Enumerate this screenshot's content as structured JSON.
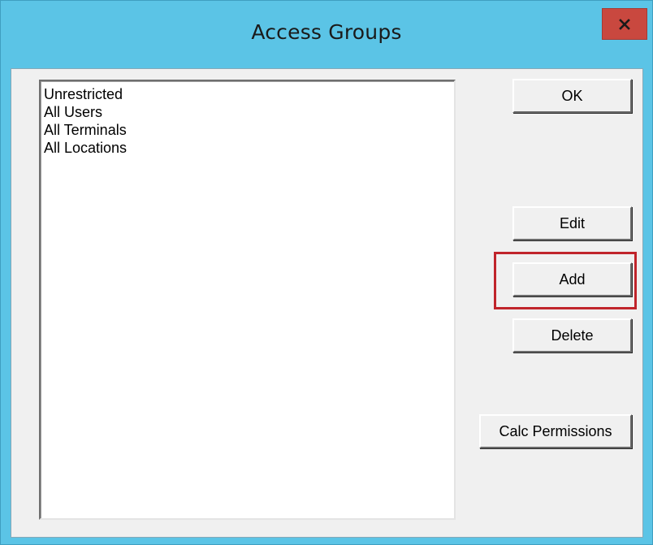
{
  "window": {
    "title": "Access Groups",
    "close_icon": "close-x-icon"
  },
  "list": {
    "items": [
      "Unrestricted",
      "All Users",
      "All Terminals",
      "All Locations"
    ]
  },
  "buttons": {
    "ok": "OK",
    "edit": "Edit",
    "add": "Add",
    "delete": "Delete",
    "calc_permissions": "Calc Permissions"
  },
  "annotation": {
    "highlight_color": "#c0242b",
    "highlighted_control": "Add"
  },
  "colors": {
    "title_bar": "#5bc4e6",
    "close_button": "#c9483f",
    "dialog_face": "#f0f0f0"
  }
}
